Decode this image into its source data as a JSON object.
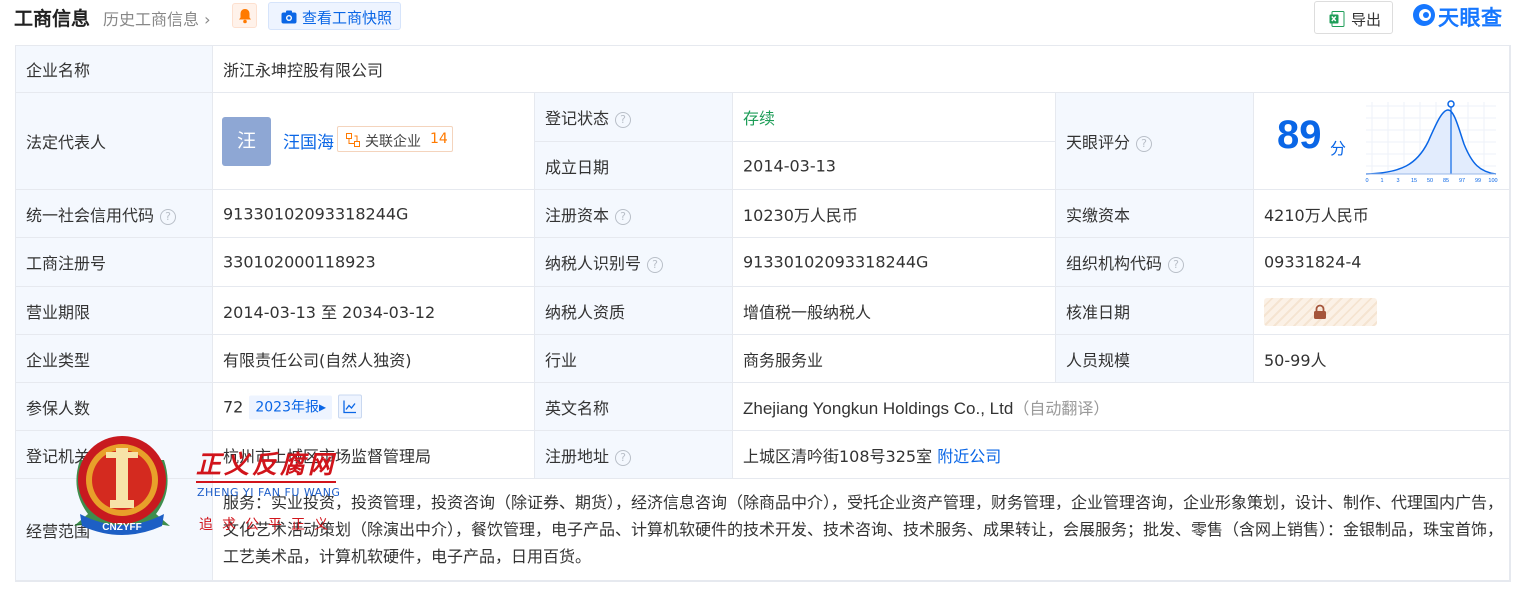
{
  "header": {
    "title": "工商信息",
    "history_link": "历史工商信息",
    "snapshot_button": "查看工商快照",
    "export_button": "导出",
    "brand": "天眼查"
  },
  "rows": {
    "company_name": {
      "label": "企业名称",
      "value": "浙江永坤控股有限公司"
    },
    "legal_rep": {
      "label": "法定代表人",
      "avatar_char": "汪",
      "name": "汪国海",
      "related_label": "关联企业",
      "related_count": "14"
    },
    "reg_status": {
      "label": "登记状态",
      "value": "存续"
    },
    "found_date": {
      "label": "成立日期",
      "value": "2014-03-13"
    },
    "tianyan_score": {
      "label": "天眼评分",
      "value": "89",
      "unit": "分"
    },
    "credit_code": {
      "label": "统一社会信用代码",
      "value": "91330102093318244G"
    },
    "reg_capital": {
      "label": "注册资本",
      "value": "10230万人民币"
    },
    "paid_capital": {
      "label": "实缴资本",
      "value": "4210万人民币"
    },
    "reg_no": {
      "label": "工商注册号",
      "value": "330102000118923"
    },
    "taxpayer_id": {
      "label": "纳税人识别号",
      "value": "91330102093318244G"
    },
    "org_code": {
      "label": "组织机构代码",
      "value": "09331824-4"
    },
    "term": {
      "label": "营业期限",
      "value": "2014-03-13 至 2034-03-12"
    },
    "taxpayer_qual": {
      "label": "纳税人资质",
      "value": "增值税一般纳税人"
    },
    "approve_date": {
      "label": "核准日期"
    },
    "company_type": {
      "label": "企业类型",
      "value": "有限责任公司(自然人独资)"
    },
    "industry": {
      "label": "行业",
      "value": "商务服务业"
    },
    "staff_size": {
      "label": "人员规模",
      "value": "50-99人"
    },
    "insured": {
      "label": "参保人数",
      "value": "72",
      "report": "2023年报"
    },
    "english_name": {
      "label": "英文名称",
      "value": "Zhejiang Yongkun Holdings Co., Ltd",
      "note": "（自动翻译）"
    },
    "reg_authority": {
      "label": "登记机关",
      "value": "杭州市上城区市场监督管理局"
    },
    "reg_address": {
      "label": "注册地址",
      "value": "上城区清吟街108号325室",
      "link": "附近公司"
    },
    "business_scope": {
      "label": "经营范围",
      "value": "服务：实业投资，投资管理，投资咨询（除证券、期货），经济信息咨询（除商品中介），受托企业资产管理，财务管理，企业管理咨询，企业形象策划，设计、制作、代理国内广告，文化艺术活动策划（除演出中介），餐饮管理，电子产品、计算机软硬件的技术开发、技术咨询、技术服务、成果转让，会展服务；批发、零售（含网上销售）：金银制品，珠宝首饰，工艺美术品，计算机软硬件，电子产品，日用百货。"
    }
  },
  "score_chart_ticks": [
    "0",
    "1",
    "3",
    "15",
    "50",
    "85",
    "97",
    "99",
    "100"
  ],
  "watermark": {
    "title": "正义反腐网",
    "pinyin": "ZHENG YI FAN FU WANG",
    "slogan": "追求公平正义",
    "seal_text": "CNZYFF"
  },
  "colors": {
    "accent": "#0a66e6",
    "label_bg": "#f4f8fe",
    "status_green": "#1e9d58",
    "border": "#e6e9ef"
  }
}
